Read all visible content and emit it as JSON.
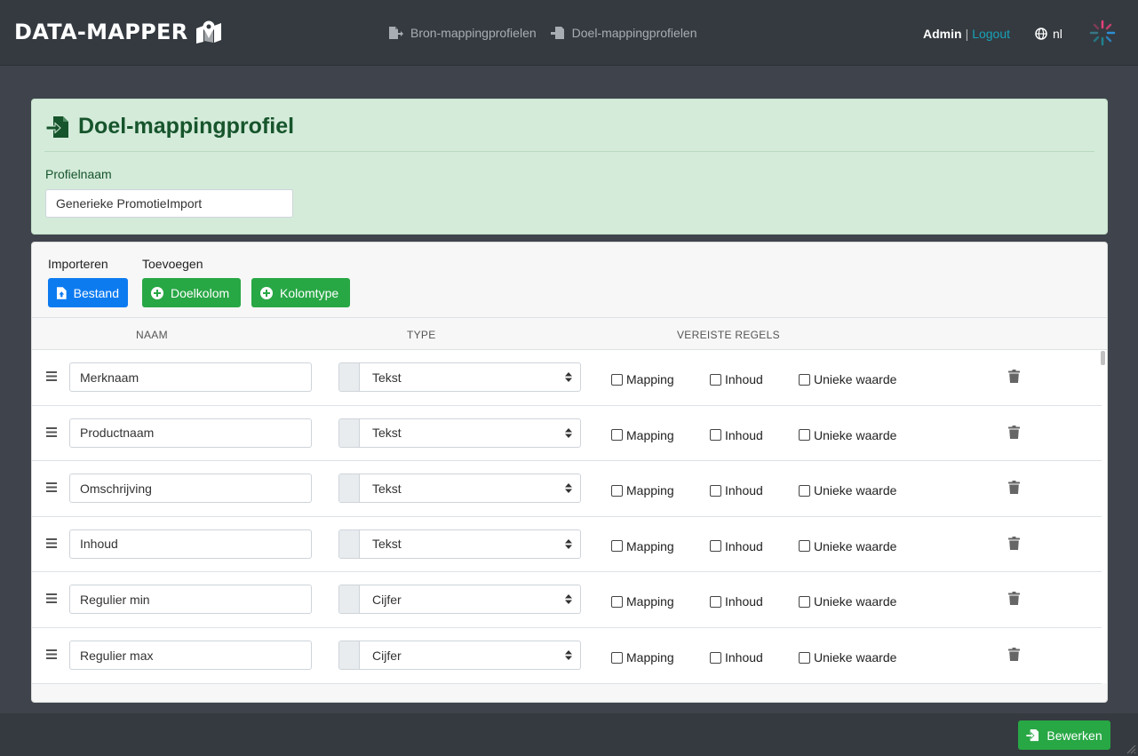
{
  "brand": {
    "name": "DATA-MAPPER",
    "icon": "map-marker-icon"
  },
  "nav": {
    "links": [
      {
        "label": "Bron-mappingprofielen",
        "icon": "file-export-icon"
      },
      {
        "label": "Doel-mappingprofielen",
        "icon": "file-import-icon"
      }
    ]
  },
  "user": {
    "name": "Admin",
    "separator": "|",
    "logout": "Logout"
  },
  "language": {
    "code": "nl",
    "icon": "globe-icon"
  },
  "header": {
    "title": "Doel-mappingprofiel",
    "profile_label": "Profielnaam",
    "profile_value": "Generieke PromotieImport"
  },
  "toolbar": {
    "import_label": "Importeren",
    "add_label": "Toevoegen",
    "file_button": "Bestand",
    "target_column_button": "Doelkolom",
    "column_type_button": "Kolomtype"
  },
  "table": {
    "headers": {
      "name": "NAAM",
      "type": "TYPE",
      "rules": "VEREISTE REGELS"
    },
    "checkbox_labels": {
      "mapping": "Mapping",
      "content": "Inhoud",
      "unique": "Unieke waarde"
    },
    "rows": [
      {
        "name": "Merknaam",
        "type": "Tekst",
        "mapping": false,
        "content": false,
        "unique": false
      },
      {
        "name": "Productnaam",
        "type": "Tekst",
        "mapping": false,
        "content": false,
        "unique": false
      },
      {
        "name": "Omschrijving",
        "type": "Tekst",
        "mapping": false,
        "content": false,
        "unique": false
      },
      {
        "name": "Inhoud",
        "type": "Tekst",
        "mapping": false,
        "content": false,
        "unique": false
      },
      {
        "name": "Regulier min",
        "type": "Cijfer",
        "mapping": false,
        "content": false,
        "unique": false
      },
      {
        "name": "Regulier max",
        "type": "Cijfer",
        "mapping": false,
        "content": false,
        "unique": false
      }
    ]
  },
  "footer": {
    "edit_button": "Bewerken"
  },
  "colors": {
    "navbar": "#343a40",
    "primary": "#0d7bf0",
    "success": "#28a745",
    "header_bg": "#d4ebda",
    "header_text": "#17552c",
    "link": "#17a2b8"
  }
}
